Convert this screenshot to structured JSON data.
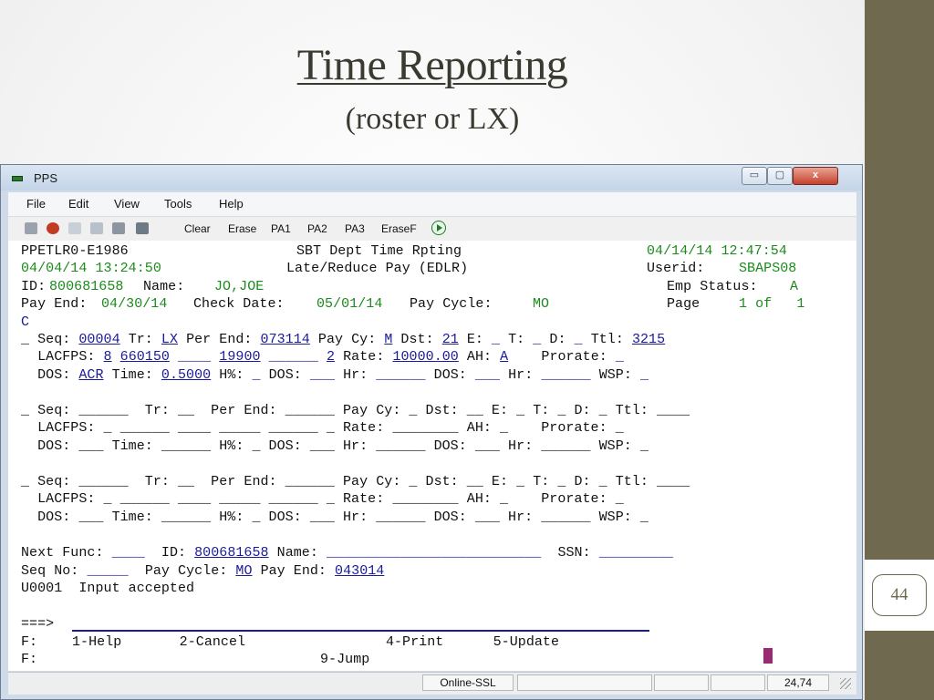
{
  "slide": {
    "title": "Time Reporting",
    "subtitle": "(roster or LX)",
    "page_number": "44"
  },
  "window": {
    "title": "PPS",
    "controls": {
      "minimize": "▭",
      "maximize": "▢",
      "close": "x"
    }
  },
  "menu": [
    "File",
    "Edit",
    "View",
    "Tools",
    "Help"
  ],
  "toolbar": {
    "icons": [
      "print-icon",
      "disconnect-icon",
      "copy-icon",
      "paste-icon",
      "printer-icon",
      "macro-icon"
    ],
    "buttons": [
      "Clear",
      "Erase",
      "PA1",
      "PA2",
      "PA3",
      "EraseF"
    ],
    "play_icon": "play-icon"
  },
  "terminal": {
    "l1": "PPETLR0-E1986",
    "l1b": "SBT Dept Time Rpting",
    "l1c": "04/14/14 12:47:54",
    "l2": "04/04/14 13:24:50",
    "l2b": "Late/Reduce Pay (EDLR)",
    "l2c_label": "Userid:",
    "l2c_value": "SBAPS08",
    "id_label": "ID:",
    "id_value": "800681658",
    "name_label": "Name:",
    "name_value": "JO,JOE",
    "emp_status_label": "Emp Status:",
    "emp_status_value": "A",
    "pay_end_label": "Pay End:",
    "pay_end_value": "04/30/14",
    "check_date_label": "Check Date:",
    "check_date_value": "05/01/14",
    "pay_cycle_label": "Pay Cycle:",
    "pay_cycle_value": "MO",
    "page_label": "Page",
    "page_value": "1 of   1",
    "c_line": "C",
    "entry1": {
      "seq": "00004",
      "tr": "LX",
      "per_end": "073114",
      "pay_cy": "M",
      "dst": "21",
      "e": "_",
      "t": "_",
      "d": "_",
      "ttl": "3215",
      "lacfps1": "8",
      "lacfps2": "660150",
      "lacfps3": "____",
      "lacfps4": "19900",
      "lacfps5": "______",
      "lacfps6": "2",
      "rate": "10000.00",
      "ah": "A",
      "prorate": "_",
      "dos": "ACR",
      "time": "0.5000",
      "hpct": "_",
      "dos2": "___",
      "hr": "______",
      "dos3": "___",
      "hr2": "______",
      "wsp": "_"
    },
    "entry_blank": {
      "seq_line": "_ Seq: ______  Tr: __  Per End: ______ Pay Cy: _ Dst: __ E: _ T: _ D: _ Ttl: ____",
      "lacfps_line": "  LACFPS: _ ______ ____ _____ ______ _ Rate: ________ AH: _    Prorate: _",
      "dos_line": "  DOS: ___ Time: ______ H%: _ DOS: ___ Hr: ______ DOS: ___ Hr: ______ WSP: _"
    },
    "next_func_label": "Next Func:",
    "next_func_value": "____",
    "id2_label": "ID:",
    "id2_value": "800681658",
    "name2_label": "Name:",
    "name2_value": "__________________________",
    "ssn_label": "SSN:",
    "ssn_value": "_________",
    "seq_no_label": "Seq No:",
    "seq_no_value": "_____",
    "pay_cycle2_label": "Pay Cycle:",
    "pay_cycle2_value": "MO",
    "pay_end2_label": "Pay End:",
    "pay_end2_value": "043014",
    "message": "U0001  Input accepted",
    "prompt": "===>",
    "f1_label": "F:",
    "f1_keys": "1-Help       2-Cancel                 4-Print      5-Update",
    "f2_label": "F:",
    "f2_keys": "9-Jump"
  },
  "statusbar": {
    "connection": "Online-SSL",
    "cursor": "24,74"
  }
}
